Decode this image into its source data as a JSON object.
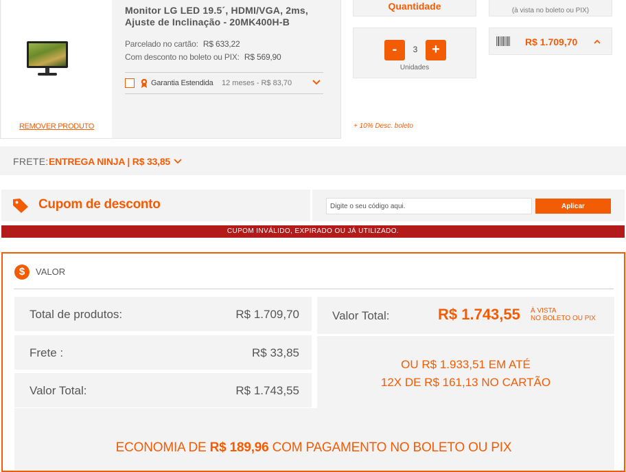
{
  "product": {
    "title": "Monitor LG LED 19.5´, HDMI/VGA, 2ms, Ajuste de Inclinação - 20MK400H-B",
    "installment_label": "Parcelado no cartão:",
    "installment_price": "R$  633,22",
    "boleto_label": "Com desconto no boleto ou PIX:",
    "boleto_price": "R$  569,90",
    "remove_label": "REMOVER PRODUTO",
    "warranty": {
      "label": "Garantia Estendida",
      "detail": "12 meses - R$  83,70",
      "checked": false
    }
  },
  "quantity": {
    "header": "Quantidade",
    "value": "3",
    "minus_label": "-",
    "plus_label": "+",
    "unit_label": "Unidades",
    "discount_note": "+ 10% Desc. boleto"
  },
  "total_column": {
    "header_note": "(à vista no boleto ou PIX)",
    "value": "R$  1.709,70"
  },
  "shipping": {
    "label": "FRETE:",
    "option": "ENTREGA NINJA  |  R$  33,85"
  },
  "coupon": {
    "title": "Cupom de desconto",
    "placeholder": "Digite o seu código aqui.",
    "apply_label": "Aplicar",
    "error": "CUPOM INVÁLIDO, EXPIRADO OU JÁ UTILIZADO."
  },
  "summary": {
    "title": "VALOR",
    "icon_symbol": "$",
    "rows": [
      {
        "label": "Total de produtos:",
        "value": "R$  1.709,70"
      },
      {
        "label": "Frete :",
        "value": "R$  33,85"
      },
      {
        "label": "Valor Total:",
        "value": "R$  1.743,55"
      }
    ],
    "right_label": "Valor Total:",
    "right_value": "R$  1.743,55",
    "right_note_line1": "À VISTA",
    "right_note_line2": "NO BOLETO OU PIX",
    "installments_line1": "OU R$  1.933,51 EM ATÉ",
    "installments_line2": "12X DE R$  161,13 NO CARTÃO",
    "economy_prefix": "ECONOMIA DE ",
    "economy_value": "R$  189,96",
    "economy_suffix": " COM PAGAMENTO NO BOLETO OU PIX"
  },
  "colors": {
    "accent": "#f25c05",
    "error": "#b31b1b",
    "panel_bg": "#f3f3f3"
  }
}
